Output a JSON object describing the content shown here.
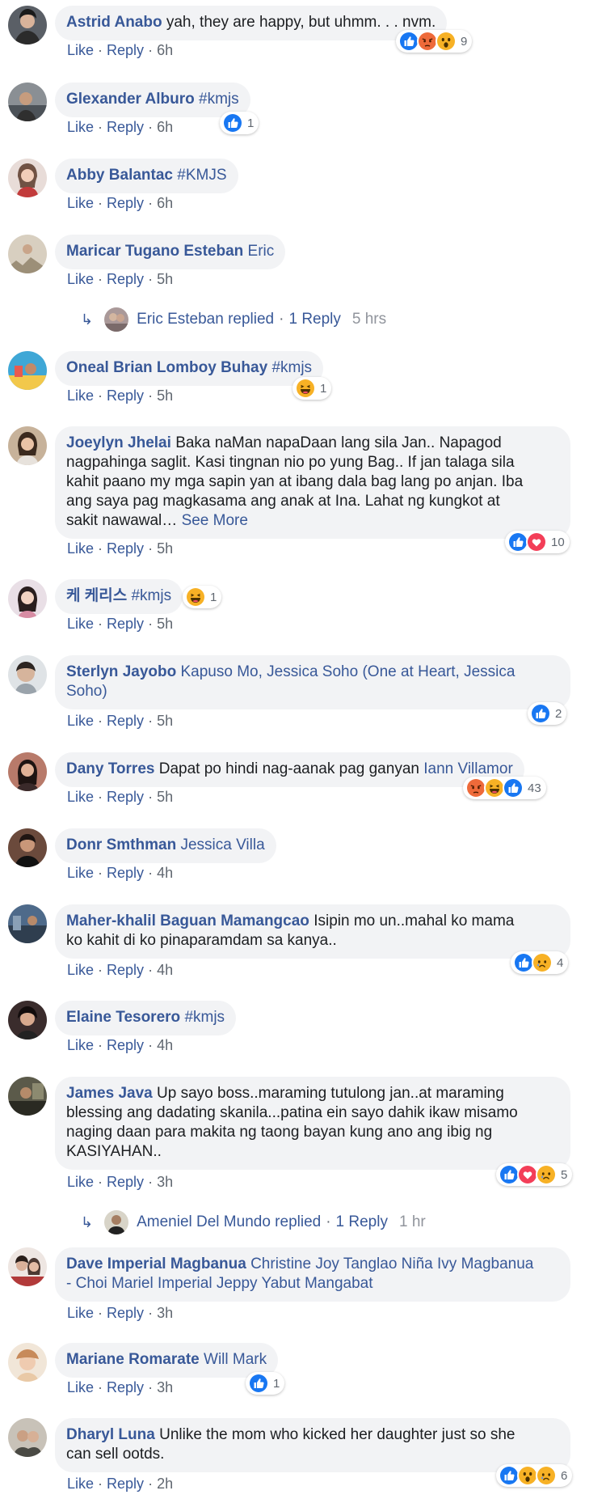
{
  "actions": {
    "like": "Like",
    "reply": "Reply",
    "sep": "·"
  },
  "colors": {
    "link": "#385898",
    "bubble": "#f2f3f5",
    "like": "#1877f2",
    "love": "#f33e58",
    "emoji": "#f7b125"
  },
  "comments": [
    {
      "author": "Astrid Anabo",
      "text": "yah, they are happy, but uhmm. . . nvm.",
      "time": "6h",
      "reactions": {
        "icons": [
          "like",
          "angry",
          "wow"
        ],
        "count": "9"
      }
    },
    {
      "author": "Glexander Alburo",
      "tag": "#kmjs",
      "time": "6h",
      "reactions": {
        "icons": [
          "like"
        ],
        "count": "1"
      }
    },
    {
      "author": "Abby Balantac",
      "tag": "#KMJS",
      "time": "6h"
    },
    {
      "author": "Maricar Tugano Esteban",
      "tag": "Eric",
      "time": "5h",
      "reply": {
        "name": "Eric Esteban replied",
        "link": "1 Reply",
        "time": "5 hrs"
      }
    },
    {
      "author": "Oneal Brian Lomboy Buhay",
      "tag": "#kmjs",
      "time": "5h",
      "reactions": {
        "icons": [
          "haha"
        ],
        "count": "1"
      }
    },
    {
      "author": "Joeylyn Jhelai",
      "text_line1": "Baka naMan napaDaan lang sila Jan.. Napagod",
      "text_line2": "nagpahinga saglit. Kasi tingnan nio po yung Bag.. If jan talaga sila",
      "text_line3": "kahit paano my mga sapin yan at ibang dala bag lang po anjan. Iba",
      "text_line4": "ang saya pag magkasama ang anak at Ina. Lahat ng kungkot at",
      "text_line5": "sakit nawawal…",
      "see_more": "See More",
      "time": "5h",
      "reactions": {
        "icons": [
          "like",
          "love"
        ],
        "count": "10"
      }
    },
    {
      "author": "케 케리스",
      "tag": "#kmjs",
      "time": "5h",
      "reactions": {
        "icons": [
          "haha"
        ],
        "count": "1"
      }
    },
    {
      "author": "Sterlyn Jayobo",
      "tag_line1": "Kapuso Mo, Jessica Soho (One at Heart, Jessica",
      "tag_line2": "Soho)",
      "time": "5h",
      "reactions": {
        "icons": [
          "like"
        ],
        "count": "2"
      }
    },
    {
      "author": "Dany Torres",
      "text": "Dapat po hindi nag-aanak pag ganyan",
      "tag": "Iann Villamor",
      "time": "5h",
      "reactions": {
        "icons": [
          "angry",
          "haha",
          "like"
        ],
        "count": "43"
      }
    },
    {
      "author": "Donr Smthman",
      "tag": "Jessica Villa",
      "time": "4h"
    },
    {
      "author": "Maher-khalil Baguan Mamangcao",
      "text_line1": "Isipin mo un..mahal ko mama",
      "text_line2": "ko kahit di ko pinaparamdam sa kanya..",
      "time": "4h",
      "reactions": {
        "icons": [
          "like",
          "sad"
        ],
        "count": "4"
      }
    },
    {
      "author": "Elaine Tesorero",
      "tag": "#kmjs",
      "time": "4h"
    },
    {
      "author": "James Java",
      "text_line1": "Up sayo boss..maraming tutulong jan..at maraming",
      "text_line2": "blessing ang dadating skanila...patina ein sayo dahik ikaw misamo",
      "text_line3": "naging daan para makita ng taong bayan kung ano ang ibig ng",
      "text_line4": "KASIYAHAN..",
      "time": "3h",
      "reactions": {
        "icons": [
          "like",
          "love",
          "sad"
        ],
        "count": "5"
      },
      "reply": {
        "name": "Ameniel Del Mundo replied",
        "link": "1 Reply",
        "time": "1 hr"
      }
    },
    {
      "author": "Dave Imperial Magbanua",
      "tag_line1": "Christine Joy Tanglao Niña Ivy Magbanua",
      "tag_line2": "- Choi Mariel Imperial Jeppy Yabut Mangabat",
      "time": "3h"
    },
    {
      "author": "Mariane Romarate",
      "tag": "Will Mark",
      "time": "3h",
      "reactions": {
        "icons": [
          "like"
        ],
        "count": "1"
      }
    },
    {
      "author": "Dharyl Luna",
      "text_line1": "Unlike the mom who kicked her daughter just so she",
      "text_line2": "can sell ootds.",
      "time": "2h",
      "reactions": {
        "icons": [
          "like",
          "wow",
          "sad"
        ],
        "count": "6"
      }
    }
  ]
}
